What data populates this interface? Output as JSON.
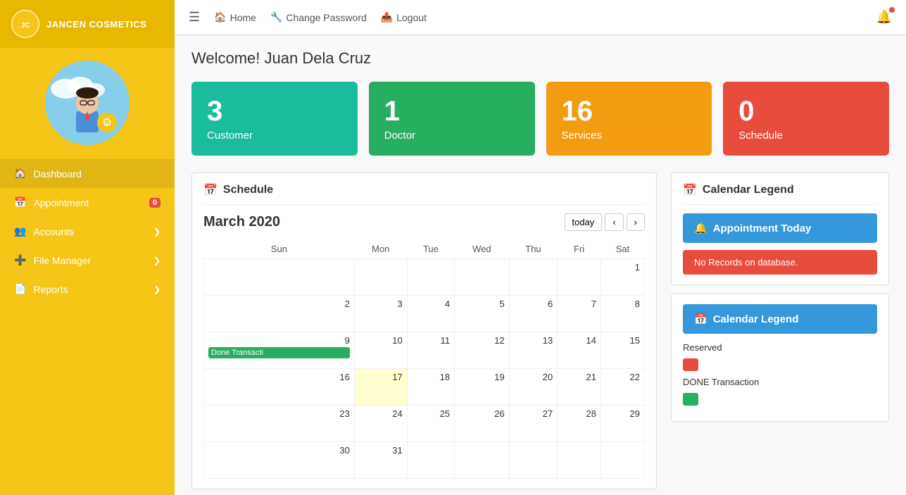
{
  "sidebar": {
    "brand": "JANCEN COSMETICS",
    "nav": [
      {
        "id": "dashboard",
        "icon": "🏠",
        "label": "Dashboard",
        "badge": null,
        "chevron": false
      },
      {
        "id": "appointment",
        "icon": "📅",
        "label": "Appointment",
        "badge": "0",
        "chevron": false
      },
      {
        "id": "accounts",
        "icon": "👥",
        "label": "Accounts",
        "badge": null,
        "chevron": true
      },
      {
        "id": "file-manager",
        "icon": "➕",
        "label": "File Manager",
        "badge": null,
        "chevron": true
      },
      {
        "id": "reports",
        "icon": "📄",
        "label": "Reports",
        "badge": null,
        "chevron": true
      }
    ]
  },
  "topbar": {
    "menu_icon": "☰",
    "links": [
      {
        "id": "home",
        "icon": "🏠",
        "label": "Home"
      },
      {
        "id": "change-password",
        "icon": "🔧",
        "label": "Change Password"
      },
      {
        "id": "logout",
        "icon": "📤",
        "label": "Logout"
      }
    ]
  },
  "welcome": {
    "title": "Welcome! Juan Dela Cruz"
  },
  "stats": [
    {
      "id": "customers",
      "number": "3",
      "label": "Customer",
      "color": "teal"
    },
    {
      "id": "doctors",
      "number": "1",
      "label": "Doctor",
      "color": "green"
    },
    {
      "id": "services",
      "number": "16",
      "label": "Services",
      "color": "yellow"
    },
    {
      "id": "schedule",
      "number": "0",
      "label": "Schedule",
      "color": "red"
    }
  ],
  "schedule": {
    "title": "Schedule",
    "month": "March 2020",
    "today_btn": "today",
    "days": [
      "Sun",
      "Mon",
      "Tue",
      "Wed",
      "Thu",
      "Fri",
      "Sat"
    ],
    "weeks": [
      [
        null,
        null,
        null,
        null,
        null,
        null,
        "1",
        "2",
        "3",
        "4",
        "5",
        "6",
        "7"
      ],
      [
        "8",
        "9",
        "10",
        "11",
        "12",
        "13",
        "14"
      ],
      [
        "15",
        "16",
        "17",
        "18",
        "19",
        "20",
        "21"
      ],
      [
        "22",
        "23",
        "24",
        "25",
        "26",
        "27",
        "28"
      ],
      [
        "29",
        "30",
        "31",
        null,
        null,
        null,
        null
      ]
    ],
    "event": {
      "day": "9",
      "label": "Done Transacti"
    }
  },
  "calendar_legend_top": {
    "title": "Calendar Legend",
    "appointment_today_label": "Appointment Today",
    "no_records": "No Records on database."
  },
  "calendar_legend_bottom": {
    "title": "Calendar Legend",
    "items": [
      {
        "color": "red",
        "label": "Reserved"
      },
      {
        "color": "green",
        "label": "DONE Transaction"
      }
    ]
  }
}
